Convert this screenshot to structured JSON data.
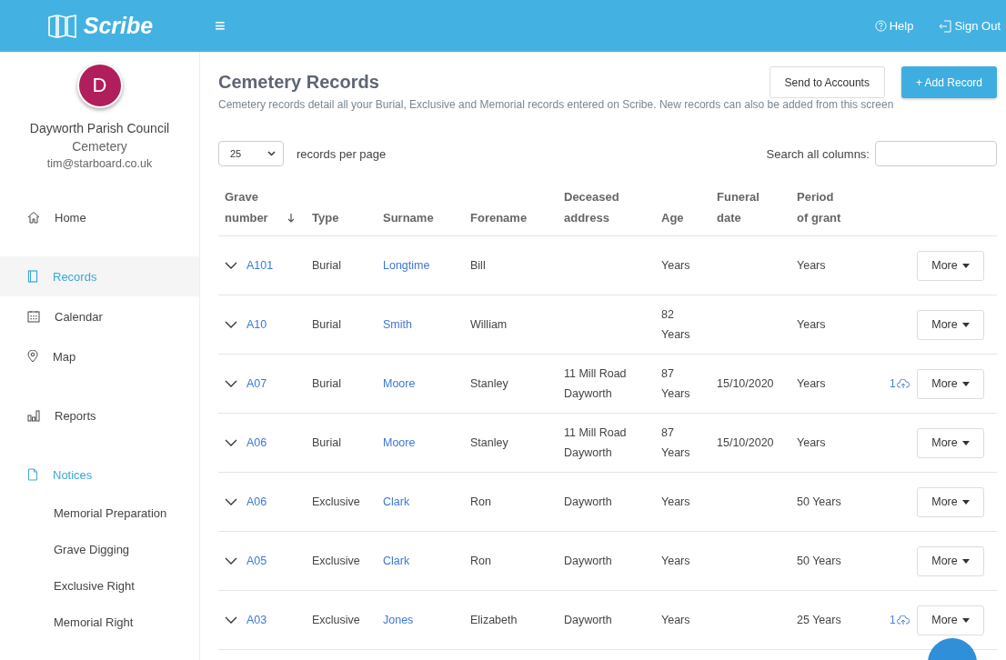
{
  "topbar": {
    "logo": "Scribe",
    "menu_icon": "≡",
    "links": [
      {
        "label": "Help",
        "kind": "help"
      },
      {
        "label": "Sign Out",
        "kind": "signout"
      }
    ]
  },
  "sidebar": {
    "avatar": "D",
    "org": "Dayworth Parish Council",
    "subtitle": "Cemetery",
    "email": "tim@starboard.co.uk",
    "items": [
      {
        "label": "Home",
        "selected": false
      },
      {
        "label": "Records",
        "selected": true
      },
      {
        "label": "Calendar",
        "selected": false
      },
      {
        "label": "Map",
        "selected": false
      },
      {
        "label": "Reports",
        "selected": false
      },
      {
        "label": "Notices",
        "selected": true,
        "children": [
          {
            "label": "Memorial Preparation"
          },
          {
            "label": "Grave Digging"
          },
          {
            "label": "Exclusive Right"
          },
          {
            "label": "Memorial Right"
          }
        ]
      }
    ]
  },
  "page": {
    "title": "Cemetery Records",
    "description": "Cemetery records detail all your Burial, Exclusive and Memorial records entered on Scribe. New records can also be added from this screen",
    "buttons": [
      {
        "label": "Send to Accounts",
        "kind": "secondary"
      },
      {
        "label": "+ Add Record",
        "kind": "primary"
      }
    ]
  },
  "controls": {
    "page_size": "25",
    "page_size_label": "records per page",
    "search_label": "Search all columns:"
  },
  "table": {
    "columns": [
      {
        "label": "Grave number",
        "sorted": true
      },
      {
        "label": "Type",
        "sorted": false
      },
      {
        "label": "Surname",
        "sorted": false
      },
      {
        "label": "Forename",
        "sorted": false
      },
      {
        "label": "Deceased address",
        "sorted": false
      },
      {
        "label": "Age",
        "sorted": false
      },
      {
        "label": "Funeral date",
        "sorted": false
      },
      {
        "label": "Period of grant",
        "sorted": false
      }
    ],
    "rows": [
      {
        "grave": "A101",
        "type": "Burial",
        "surname": "Longtime",
        "forename": "Bill",
        "age": "Years",
        "period": "Years",
        "more": "More"
      },
      {
        "grave": "A10",
        "type": "Burial",
        "surname": "Smith",
        "forename": "William",
        "age": "82 Years",
        "period": "Years",
        "more": "More"
      },
      {
        "grave": "A07",
        "type": "Burial",
        "surname": "Moore",
        "forename": "Stanley",
        "address": "11 Mill Road Dayworth",
        "age": "87 Years",
        "funeral": "15/10/2020",
        "period": "Years",
        "attachments": "1",
        "more": "More"
      },
      {
        "grave": "A06",
        "type": "Burial",
        "surname": "Moore",
        "forename": "Stanley",
        "address": "11 Mill Road Dayworth",
        "age": "87 Years",
        "funeral": "15/10/2020",
        "period": "Years",
        "more": "More"
      },
      {
        "grave": "A06",
        "type": "Exclusive",
        "surname": "Clark",
        "forename": "Ron",
        "address": "Dayworth",
        "age": "Years",
        "period": "50 Years",
        "more": "More"
      },
      {
        "grave": "A05",
        "type": "Exclusive",
        "surname": "Clark",
        "forename": "Ron",
        "address": "Dayworth",
        "age": "Years",
        "period": "50 Years",
        "more": "More"
      },
      {
        "grave": "A03",
        "type": "Exclusive",
        "surname": "Jones",
        "forename": "Elizabeth",
        "address": "Dayworth",
        "age": "Years",
        "period": "25 Years",
        "attachments": "1",
        "more": "More"
      }
    ]
  }
}
